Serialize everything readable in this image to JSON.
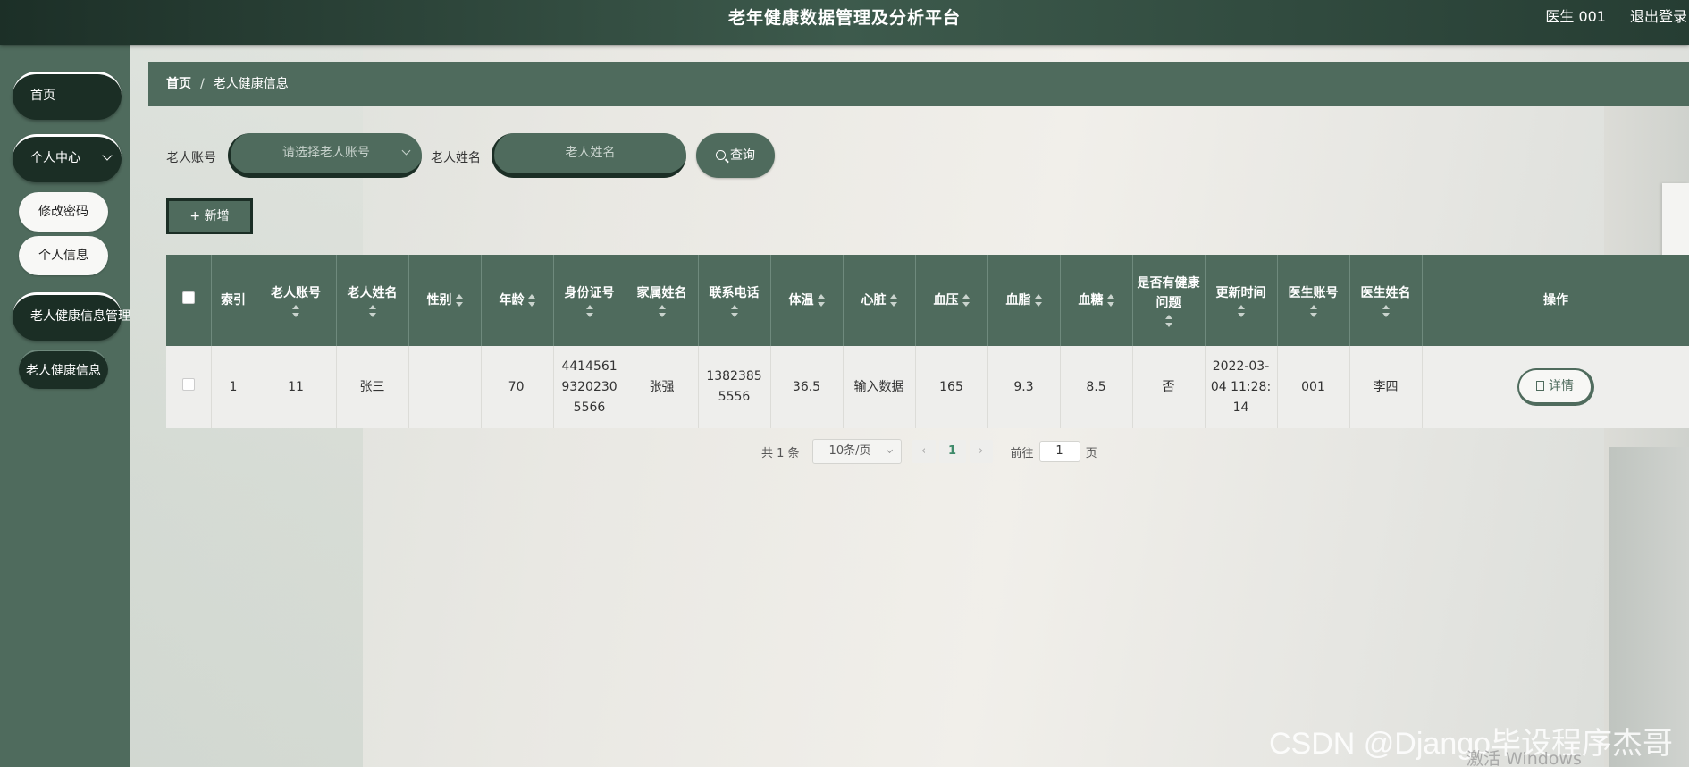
{
  "header": {
    "title": "老年健康数据管理及分析平台",
    "user": "医生 001",
    "logout": "退出登录"
  },
  "sidebar": {
    "home": "首页",
    "personal_center": "个人中心",
    "personal_sub": [
      "修改密码",
      "个人信息"
    ],
    "health_mgmt": "老人健康信息管理",
    "health_sub": [
      "老人健康信息"
    ]
  },
  "breadcrumb": {
    "home": "首页",
    "separator": "/",
    "current": "老人健康信息"
  },
  "search": {
    "account_label": "老人账号",
    "account_placeholder": "请选择老人账号",
    "name_label": "老人姓名",
    "name_placeholder": "老人姓名",
    "query_button": "查询"
  },
  "toolbar": {
    "add_button": "新增"
  },
  "table": {
    "columns": [
      "索引",
      "老人账号",
      "老人姓名",
      "性别",
      "年龄",
      "身份证号",
      "家属姓名",
      "联系电话",
      "体温",
      "心脏",
      "血压",
      "血脂",
      "血糖",
      "是否有健康问题",
      "更新时间",
      "医生账号",
      "医生姓名",
      "操作"
    ],
    "rows": [
      {
        "index": "1",
        "account": "11",
        "name": "张三",
        "gender": "",
        "age": "70",
        "id_card": "441456193202305566",
        "family_name": "张强",
        "phone": "13823855556",
        "temperature": "36.5",
        "heart": "输入数据",
        "blood_pressure": "165",
        "blood_lipid": "9.3",
        "blood_sugar": "8.5",
        "health_issue": "否",
        "update_time": "2022-03-04 11:28:14",
        "doctor_account": "001",
        "doctor_name": "李四",
        "action": "详情"
      }
    ]
  },
  "pagination": {
    "total": "共 1 条",
    "page_size": "10条/页",
    "current_page": "1",
    "goto_label": "前往",
    "goto_value": "1",
    "page_unit": "页"
  },
  "watermark": {
    "csdn": "CSDN @Django毕设程序杰哥",
    "windows": "激活 Windows"
  },
  "colors": {
    "primary": "#4f6b5d",
    "dark": "#1b2e25"
  }
}
